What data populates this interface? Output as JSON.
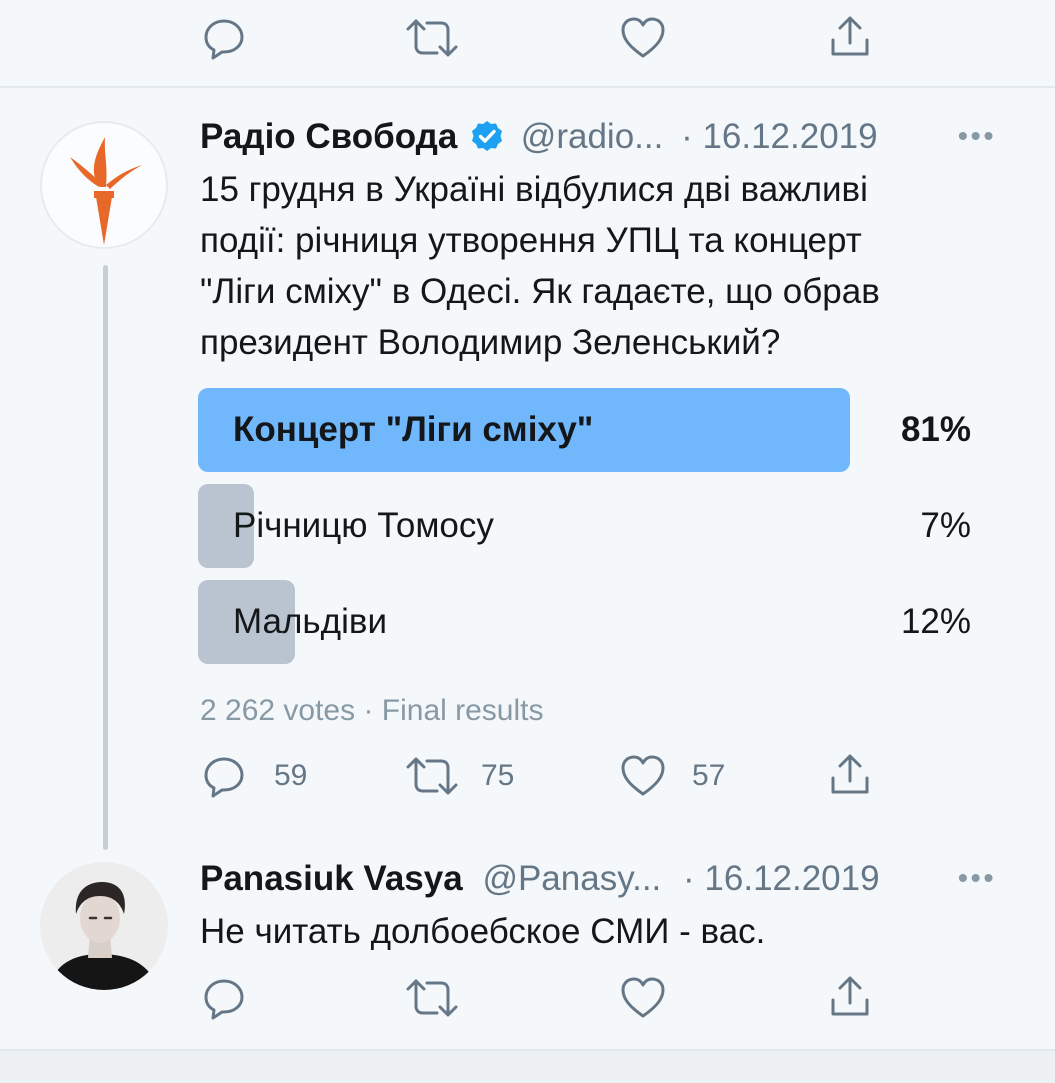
{
  "colors": {
    "background": "#f5f8fa",
    "text": "#14171a",
    "muted": "#657786",
    "poll_winner": "#71b7fb",
    "poll_other": "#b9c4d0",
    "verified": "#1da1f2",
    "logo_accent": "#e8682a"
  },
  "top_actions": {
    "reply_icon": "speech-bubble",
    "retweet_icon": "retweet-arrows",
    "like_icon": "heart",
    "share_icon": "share-arrow"
  },
  "tweet1": {
    "author_name": "Радіо Свобода",
    "verified_icon": "verified-badge",
    "handle": "@radio...",
    "date": "· 16.12.2019",
    "more": "•••",
    "text_lines": [
      "15 грудня в Україні відбулися дві важливі",
      "події: річниця утворення УПЦ та концерт",
      "\"Ліги сміху\" в Одесі. Як гадаєте, що обрав",
      "президент Володимир Зеленський?"
    ],
    "poll": {
      "options": [
        {
          "label": "Концерт \"Ліги сміху\"",
          "percent": "81%",
          "fraction": 0.81,
          "winner": true
        },
        {
          "label": "Річницю Томосу",
          "percent": "7%",
          "fraction": 0.07,
          "winner": false
        },
        {
          "label": "Мальдіви",
          "percent": "12%",
          "fraction": 0.12,
          "winner": false
        }
      ],
      "summary": "2 262 votes · Final results"
    },
    "actions": {
      "replies": "59",
      "retweets": "75",
      "likes": "57"
    }
  },
  "tweet2": {
    "author_name": "Panasiuk Vasya",
    "handle": "@Panasy...",
    "date": "· 16.12.2019",
    "more": "•••",
    "text": "Не читать долбоебское СМИ - вас."
  }
}
